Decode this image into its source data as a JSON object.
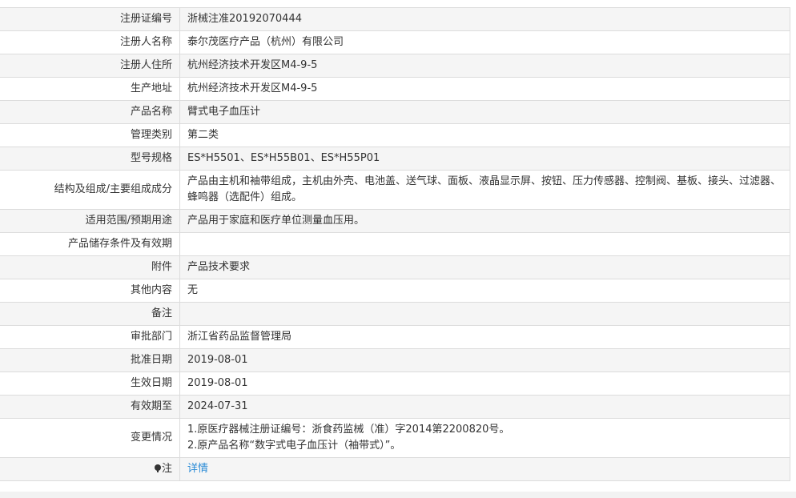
{
  "rows": [
    {
      "label": "注册证编号",
      "value": "浙械注准20192070444"
    },
    {
      "label": "注册人名称",
      "value": "泰尔茂医疗产品（杭州）有限公司"
    },
    {
      "label": "注册人住所",
      "value": "杭州经济技术开发区M4-9-5"
    },
    {
      "label": "生产地址",
      "value": "杭州经济技术开发区M4-9-5"
    },
    {
      "label": "产品名称",
      "value": "臂式电子血压计"
    },
    {
      "label": "管理类别",
      "value": "第二类"
    },
    {
      "label": "型号规格",
      "value": "ES*H5501、ES*H55B01、ES*H55P01"
    },
    {
      "label": "结构及组成/主要组成成分",
      "value": "产品由主机和袖带组成，主机由外壳、电池盖、送气球、面板、液晶显示屏、按钮、压力传感器、控制阀、基板、接头、过滤器、蜂鸣器（选配件）组成。"
    },
    {
      "label": "适用范围/预期用途",
      "value": "产品用于家庭和医疗单位测量血压用。"
    },
    {
      "label": "产品储存条件及有效期",
      "value": ""
    },
    {
      "label": "附件",
      "value": "产品技术要求"
    },
    {
      "label": "其他内容",
      "value": "无"
    },
    {
      "label": "备注",
      "value": ""
    },
    {
      "label": "审批部门",
      "value": "浙江省药品监督管理局"
    },
    {
      "label": "批准日期",
      "value": "2019-08-01"
    },
    {
      "label": "生效日期",
      "value": "2019-08-01"
    },
    {
      "label": "有效期至",
      "value": "2024-07-31"
    },
    {
      "label": "变更情况",
      "value_lines": [
        "1.原医疗器械注册证编号：浙食药监械（准）字2014第2200820号。",
        "2.原产品名称“数字式电子血压计（袖带式）”。"
      ]
    },
    {
      "label": "注",
      "icon": "bulb-icon",
      "link_text": "详情"
    }
  ],
  "colors": {
    "row_alt_bg": "#f5f5f5",
    "border": "#dcdcdc",
    "text": "#333333",
    "link": "#2a8bd6"
  }
}
